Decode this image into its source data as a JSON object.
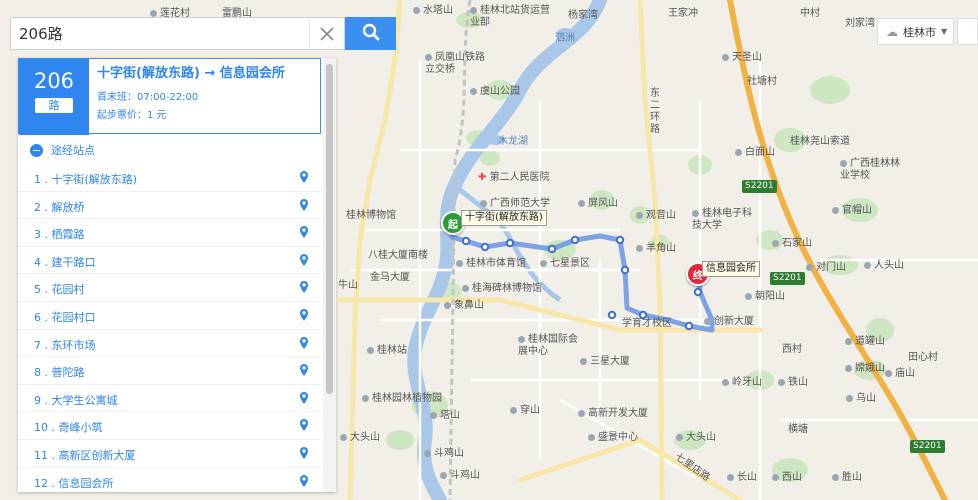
{
  "search": {
    "value": "206路"
  },
  "route": {
    "number": "206",
    "unit": "路",
    "title": "十字街(解放东路) → 信息园会所",
    "hours": "首末班：07:00-22:00",
    "fare": "起步票价：1 元"
  },
  "stops_header": "途经站点",
  "stops": [
    "1 . 十字街(解放东路)",
    "2 . 解放桥",
    "3 . 栖霞路",
    "4 . 建干路口",
    "5 . 花园村",
    "6 . 花园村口",
    "7 . 东环市场",
    "8 . 普陀路",
    "9 . 大学生公寓城",
    "10 . 奇峰小筑",
    "11 . 高新区创新大厦",
    "12 . 信息园会所"
  ],
  "city": {
    "name": "桂林市"
  },
  "markers": {
    "start_glyph": "起",
    "start_label": "十字街(解放东路)",
    "end_glyph": "终",
    "end_label": "信息园会所"
  },
  "map_labels": [
    "莲花村",
    "雷鹏山",
    "水塔山",
    "桂林北站货运营业部",
    "杨家湾",
    "王家冲",
    "中村",
    "刘家湾",
    "凤凰山铁路立交桥",
    "泗洲",
    "天圣山",
    "社塘村",
    "虞山公园",
    "东二环路",
    "木龙湖",
    "第二人民医院",
    "白面山",
    "桂林尧山索道",
    "广西桂林林业学校",
    "广西师范大学",
    "屏风山",
    "观音山",
    "桂林电子科技大学",
    "官帽山",
    "桂林博物馆",
    "石家山",
    "羊角山",
    "八桂大厦南楼",
    "桂林市体育馆",
    "七星景区",
    "对门山",
    "人头山",
    "金马大厦",
    "桂海碑林博物馆",
    "朝阳山",
    "象鼻山",
    "学育才校区",
    "创新大厦",
    "桂林站",
    "桂林国际会展中心",
    "三星大厦",
    "道罐山",
    "西村",
    "田心村",
    "嫦娥山",
    "庙山",
    "岭牙山",
    "铁山",
    "桂林园林植物园",
    "乌山",
    "高新开发大厦",
    "横塘",
    "塔山",
    "盛景中心",
    "大头山",
    "斗鸡山",
    "穿山",
    "七里店路",
    "长山",
    "西山",
    "胜山",
    "大头山",
    "牛山",
    "斗鸡山"
  ],
  "road_shields": [
    "S2201",
    "S2201",
    "S2201"
  ],
  "colors": {
    "accent": "#2e86ee",
    "route": "#6f9ae6",
    "start": "#2e9a3a",
    "end": "#e0283c"
  }
}
